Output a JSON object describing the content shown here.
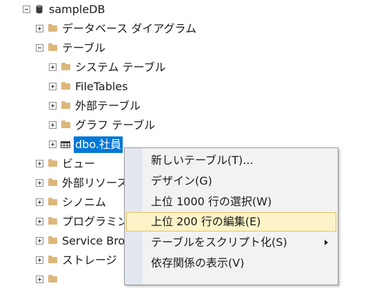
{
  "tree": {
    "root": "sampleDB",
    "items": [
      {
        "label": "データベース ダイアグラム"
      },
      {
        "label": "テーブル"
      },
      {
        "label": "システム テーブル"
      },
      {
        "label": "FileTables"
      },
      {
        "label": "外部テーブル"
      },
      {
        "label": "グラフ テーブル"
      },
      {
        "label": "dbo.社員"
      },
      {
        "label": "ビュー"
      },
      {
        "label": "外部リソース"
      },
      {
        "label": "シノニム"
      },
      {
        "label": "プログラミング"
      },
      {
        "label": "Service Brok"
      },
      {
        "label": "ストレージ"
      }
    ]
  },
  "context_menu": {
    "items": [
      {
        "label": "新しいテーブル(T)..."
      },
      {
        "label": "デザイン(G)"
      },
      {
        "label": "上位 1000 行の選択(W)"
      },
      {
        "label": "上位 200 行の編集(E)"
      },
      {
        "label": "テーブルをスクリプト化(S)"
      },
      {
        "label": "依存関係の表示(V)"
      }
    ]
  },
  "colors": {
    "selection": "#0078d7",
    "folder": "#dcb67a",
    "menu_highlight": "#fcf3c9"
  }
}
